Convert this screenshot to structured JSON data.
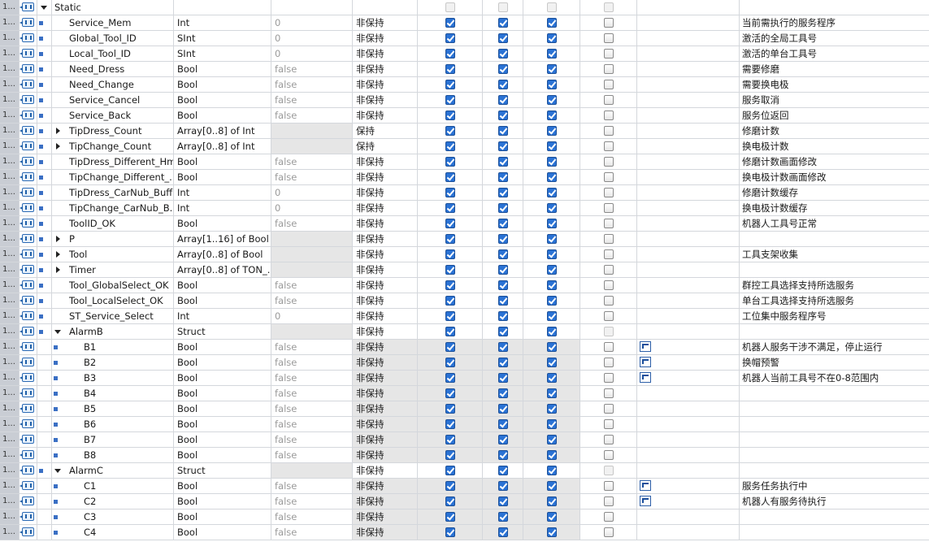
{
  "header": {
    "num": "1...",
    "name": "Static"
  },
  "rows": [
    {
      "num": "1...",
      "level": 1,
      "exp": "",
      "name": "Service_Mem",
      "type": "Int",
      "def": "0",
      "ret": "非保持",
      "c1": true,
      "c2": true,
      "c3": true,
      "c4": false,
      "set": false,
      "cmt": "当前需执行的服务程序"
    },
    {
      "num": "1...",
      "level": 1,
      "exp": "",
      "name": "Global_Tool_ID",
      "type": "SInt",
      "def": "0",
      "ret": "非保持",
      "c1": true,
      "c2": true,
      "c3": true,
      "c4": false,
      "set": false,
      "cmt": "激活的全局工具号"
    },
    {
      "num": "1...",
      "level": 1,
      "exp": "",
      "name": "Local_Tool_ID",
      "type": "SInt",
      "def": "0",
      "ret": "非保持",
      "c1": true,
      "c2": true,
      "c3": true,
      "c4": false,
      "set": false,
      "cmt": "激活的单台工具号"
    },
    {
      "num": "1...",
      "level": 1,
      "exp": "",
      "name": "Need_Dress",
      "type": "Bool",
      "def": "false",
      "ret": "非保持",
      "c1": true,
      "c2": true,
      "c3": true,
      "c4": false,
      "set": false,
      "cmt": "需要修磨"
    },
    {
      "num": "1...",
      "level": 1,
      "exp": "",
      "name": "Need_Change",
      "type": "Bool",
      "def": "false",
      "ret": "非保持",
      "c1": true,
      "c2": true,
      "c3": true,
      "c4": false,
      "set": false,
      "cmt": "需要换电极"
    },
    {
      "num": "1...",
      "level": 1,
      "exp": "",
      "name": "Service_Cancel",
      "type": "Bool",
      "def": "false",
      "ret": "非保持",
      "c1": true,
      "c2": true,
      "c3": true,
      "c4": false,
      "set": false,
      "cmt": "服务取消"
    },
    {
      "num": "1...",
      "level": 1,
      "exp": "",
      "name": "Service_Back",
      "type": "Bool",
      "def": "false",
      "ret": "非保持",
      "c1": true,
      "c2": true,
      "c3": true,
      "c4": false,
      "set": false,
      "cmt": "服务位返回"
    },
    {
      "num": "1...",
      "level": 1,
      "exp": "right",
      "name": "TipDress_Count",
      "type": "Array[0..8] of Int",
      "def": "",
      "defGray": true,
      "ret": "保持",
      "c1": true,
      "c2": true,
      "c3": true,
      "c4": false,
      "set": false,
      "cmt": "修磨计数"
    },
    {
      "num": "1...",
      "level": 1,
      "exp": "right",
      "name": "TipChange_Count",
      "type": "Array[0..8] of Int",
      "def": "",
      "defGray": true,
      "ret": "保持",
      "c1": true,
      "c2": true,
      "c3": true,
      "c4": false,
      "set": false,
      "cmt": "换电极计数"
    },
    {
      "num": "1...",
      "level": 1,
      "exp": "",
      "name": "TipDress_Different_Hmi",
      "type": "Bool",
      "def": "false",
      "ret": "非保持",
      "c1": true,
      "c2": true,
      "c3": true,
      "c4": false,
      "set": false,
      "cmt": "修磨计数画面修改"
    },
    {
      "num": "1...",
      "level": 1,
      "exp": "",
      "name": "TipChange_Different_...",
      "type": "Bool",
      "def": "false",
      "ret": "非保持",
      "c1": true,
      "c2": true,
      "c3": true,
      "c4": false,
      "set": false,
      "cmt": "换电极计数画面修改"
    },
    {
      "num": "1...",
      "level": 1,
      "exp": "",
      "name": "TipDress_CarNub_Buff...",
      "type": "Int",
      "def": "0",
      "ret": "非保持",
      "c1": true,
      "c2": true,
      "c3": true,
      "c4": false,
      "set": false,
      "cmt": "修磨计数缓存"
    },
    {
      "num": "1...",
      "level": 1,
      "exp": "",
      "name": "TipChange_CarNub_B...",
      "type": "Int",
      "def": "0",
      "ret": "非保持",
      "c1": true,
      "c2": true,
      "c3": true,
      "c4": false,
      "set": false,
      "cmt": "换电极计数缓存"
    },
    {
      "num": "1...",
      "level": 1,
      "exp": "",
      "name": "ToolID_OK",
      "type": "Bool",
      "def": "false",
      "ret": "非保持",
      "c1": true,
      "c2": true,
      "c3": true,
      "c4": false,
      "set": false,
      "cmt": "机器人工具号正常"
    },
    {
      "num": "1...",
      "level": 1,
      "exp": "right",
      "name": "P",
      "type": "Array[1..16] of Bool",
      "def": "",
      "defGray": true,
      "ret": "非保持",
      "c1": true,
      "c2": true,
      "c3": true,
      "c4": false,
      "set": false,
      "cmt": ""
    },
    {
      "num": "1...",
      "level": 1,
      "exp": "right",
      "name": "Tool",
      "type": "Array[0..8] of Bool",
      "def": "",
      "defGray": true,
      "ret": "非保持",
      "c1": true,
      "c2": true,
      "c3": true,
      "c4": false,
      "set": false,
      "cmt": "工具支架收集"
    },
    {
      "num": "1...",
      "level": 1,
      "exp": "right",
      "name": "Timer",
      "type": "Array[0..8] of TON_...",
      "def": "",
      "defGray": true,
      "ret": "非保持",
      "c1": true,
      "c2": true,
      "c3": true,
      "c4": false,
      "set": false,
      "cmt": ""
    },
    {
      "num": "1...",
      "level": 1,
      "exp": "",
      "name": "Tool_GlobalSelect_OK",
      "type": "Bool",
      "def": "false",
      "ret": "非保持",
      "c1": true,
      "c2": true,
      "c3": true,
      "c4": false,
      "set": false,
      "cmt": "群控工具选择支持所选服务"
    },
    {
      "num": "1...",
      "level": 1,
      "exp": "",
      "name": "Tool_LocalSelect_OK",
      "type": "Bool",
      "def": "false",
      "ret": "非保持",
      "c1": true,
      "c2": true,
      "c3": true,
      "c4": false,
      "set": false,
      "cmt": "单台工具选择支持所选服务"
    },
    {
      "num": "1...",
      "level": 1,
      "exp": "",
      "name": "ST_Service_Select",
      "type": "Int",
      "def": "0",
      "ret": "非保持",
      "c1": true,
      "c2": true,
      "c3": true,
      "c4": false,
      "set": false,
      "cmt": "工位集中服务程序号"
    },
    {
      "num": "1...",
      "level": 1,
      "exp": "down",
      "name": "AlarmB",
      "type": "Struct",
      "def": "",
      "defGray": true,
      "ret": "非保持",
      "c1": true,
      "c2": true,
      "c3": true,
      "c4": "dis",
      "set": false,
      "cmt": ""
    },
    {
      "num": "1...",
      "level": 2,
      "exp": "",
      "name": "B1",
      "type": "Bool",
      "def": "false",
      "ret": "非保持",
      "retGray": true,
      "c1": true,
      "c2": true,
      "c3": true,
      "c4": false,
      "set": true,
      "cmt": "机器人服务干涉不满足，停止运行"
    },
    {
      "num": "1...",
      "level": 2,
      "exp": "",
      "name": "B2",
      "type": "Bool",
      "def": "false",
      "ret": "非保持",
      "retGray": true,
      "c1": true,
      "c2": true,
      "c3": true,
      "c4": false,
      "set": true,
      "cmt": "换帽预警"
    },
    {
      "num": "1...",
      "level": 2,
      "exp": "",
      "name": "B3",
      "type": "Bool",
      "def": "false",
      "ret": "非保持",
      "retGray": true,
      "c1": true,
      "c2": true,
      "c3": true,
      "c4": false,
      "set": true,
      "cmt": "机器人当前工具号不在0-8范围内"
    },
    {
      "num": "1...",
      "level": 2,
      "exp": "",
      "name": "B4",
      "type": "Bool",
      "def": "false",
      "ret": "非保持",
      "retGray": true,
      "c1": true,
      "c2": true,
      "c3": true,
      "c4": false,
      "set": false,
      "cmt": ""
    },
    {
      "num": "1...",
      "level": 2,
      "exp": "",
      "name": "B5",
      "type": "Bool",
      "def": "false",
      "ret": "非保持",
      "retGray": true,
      "c1": true,
      "c2": true,
      "c3": true,
      "c4": false,
      "set": false,
      "cmt": ""
    },
    {
      "num": "1...",
      "level": 2,
      "exp": "",
      "name": "B6",
      "type": "Bool",
      "def": "false",
      "ret": "非保持",
      "retGray": true,
      "c1": true,
      "c2": true,
      "c3": true,
      "c4": false,
      "set": false,
      "cmt": ""
    },
    {
      "num": "1...",
      "level": 2,
      "exp": "",
      "name": "B7",
      "type": "Bool",
      "def": "false",
      "ret": "非保持",
      "retGray": true,
      "c1": true,
      "c2": true,
      "c3": true,
      "c4": false,
      "set": false,
      "cmt": ""
    },
    {
      "num": "1...",
      "level": 2,
      "exp": "",
      "name": "B8",
      "type": "Bool",
      "def": "false",
      "ret": "非保持",
      "retGray": true,
      "c1": true,
      "c2": true,
      "c3": true,
      "c4": false,
      "set": false,
      "cmt": ""
    },
    {
      "num": "1...",
      "level": 1,
      "exp": "down",
      "name": "AlarmC",
      "type": "Struct",
      "def": "",
      "defGray": true,
      "ret": "非保持",
      "c1": true,
      "c2": true,
      "c3": true,
      "c4": "dis",
      "set": false,
      "cmt": ""
    },
    {
      "num": "1...",
      "level": 2,
      "exp": "",
      "name": "C1",
      "type": "Bool",
      "def": "false",
      "ret": "非保持",
      "retGray": true,
      "c1": true,
      "c2": true,
      "c3": true,
      "c4": false,
      "set": true,
      "cmt": "服务任务执行中"
    },
    {
      "num": "1...",
      "level": 2,
      "exp": "",
      "name": "C2",
      "type": "Bool",
      "def": "false",
      "ret": "非保持",
      "retGray": true,
      "c1": true,
      "c2": true,
      "c3": true,
      "c4": false,
      "set": true,
      "cmt": "机器人有服务待执行"
    },
    {
      "num": "1...",
      "level": 2,
      "exp": "",
      "name": "C3",
      "type": "Bool",
      "def": "false",
      "ret": "非保持",
      "retGray": true,
      "c1": true,
      "c2": true,
      "c3": true,
      "c4": false,
      "set": false,
      "cmt": ""
    },
    {
      "num": "1...",
      "level": 2,
      "exp": "",
      "name": "C4",
      "type": "Bool",
      "def": "false",
      "ret": "非保持",
      "retGray": true,
      "c1": true,
      "c2": true,
      "c3": true,
      "c4": false,
      "set": false,
      "cmt": ""
    }
  ]
}
